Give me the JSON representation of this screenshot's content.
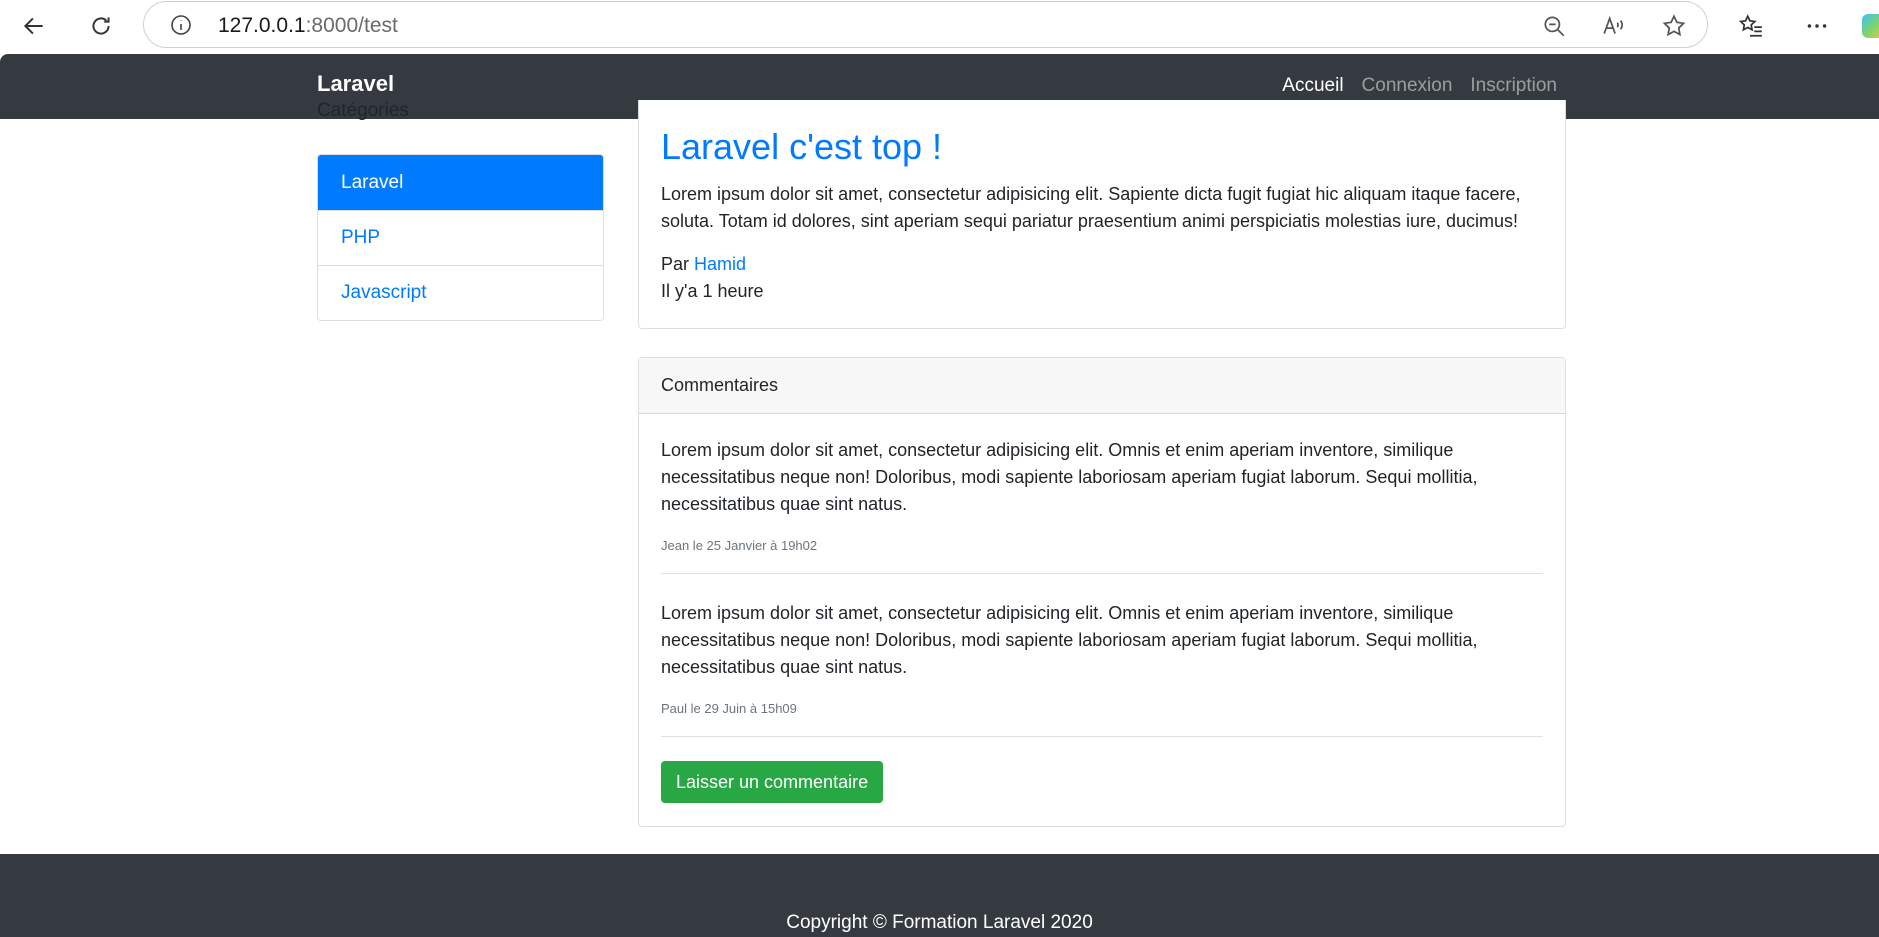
{
  "browser": {
    "url_host": "127.0.0.1",
    "url_rest": ":8000/test"
  },
  "navbar": {
    "brand": "Laravel",
    "links": [
      {
        "label": "Accueil",
        "active": true
      },
      {
        "label": "Connexion",
        "active": false
      },
      {
        "label": "Inscription",
        "active": false
      }
    ]
  },
  "sidebar": {
    "title": "Catégories",
    "items": [
      {
        "label": "Laravel",
        "active": true
      },
      {
        "label": "PHP",
        "active": false
      },
      {
        "label": "Javascript",
        "active": false
      }
    ]
  },
  "post": {
    "title": "Laravel c'est top !",
    "body": "Lorem ipsum dolor sit amet, consectetur adipisicing elit. Sapiente dicta fugit fugiat hic aliquam itaque facere, soluta. Totam id dolores, sint aperiam sequi pariatur praesentium animi perspiciatis molestias iure, ducimus!",
    "author_prefix": "Par",
    "author": "Hamid",
    "time": "Il y'a 1 heure"
  },
  "comments": {
    "header": "Commentaires",
    "items": [
      {
        "text": "Lorem ipsum dolor sit amet, consectetur adipisicing elit. Omnis et enim aperiam inventore, similique necessitatibus neque non! Doloribus, modi sapiente laboriosam aperiam fugiat laborum. Sequi mollitia, necessitatibus quae sint natus.",
        "meta": "Jean le 25 Janvier à 19h02"
      },
      {
        "text": "Lorem ipsum dolor sit amet, consectetur adipisicing elit. Omnis et enim aperiam inventore, similique necessitatibus neque non! Doloribus, modi sapiente laboriosam aperiam fugiat laborum. Sequi mollitia, necessitatibus quae sint natus.",
        "meta": "Paul le 29 Juin à 15h09"
      }
    ],
    "button": "Laisser un commentaire"
  },
  "footer": {
    "copyright": "Copyright © Formation Laravel 2020"
  },
  "colors": {
    "primary": "#007bff",
    "success": "#28a745",
    "dark": "#343a40"
  }
}
